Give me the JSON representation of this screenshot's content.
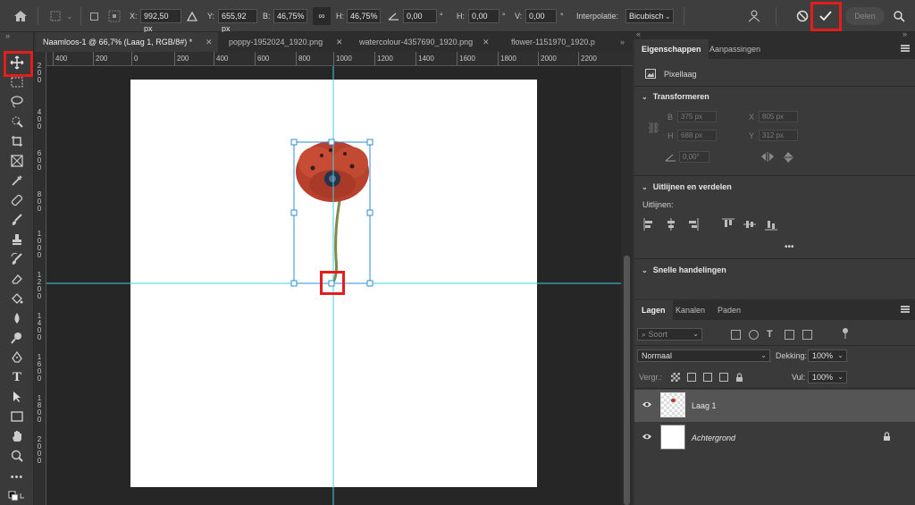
{
  "options_bar": {
    "x_label": "X:",
    "x_value": "992,50 px",
    "y_label": "Y:",
    "y_value": "655,92 px",
    "w_label": "B:",
    "w_value": "46,75%",
    "h_label": "H:",
    "h_value": "46,75%",
    "angle_value": "0,00",
    "degree": "°",
    "hskew_label": "H:",
    "hskew_value": "0,00",
    "vskew_label": "V:",
    "vskew_value": "0,00",
    "interp_label": "Interpolatie:",
    "interp_value": "Bicubisch",
    "share_label": "Delen"
  },
  "tabs": [
    {
      "label": "Naamloos-1 @ 66,7% (Laag 1, RGB/8#) *",
      "active": true
    },
    {
      "label": "poppy-1952024_1920.png",
      "active": false
    },
    {
      "label": "watercolour-4357690_1920.png",
      "active": false
    },
    {
      "label": "flower-1151970_1920.p",
      "active": false
    }
  ],
  "ruler_top": [
    "400",
    "200",
    "0",
    "200",
    "400",
    "600",
    "800",
    "1000",
    "1200",
    "1400",
    "1600",
    "1800",
    "2000",
    "2200"
  ],
  "ruler_left": [
    "2\n0\n0",
    "4\n0\n0",
    "6\n0\n0",
    "8\n0\n0",
    "1\n0\n0\n0",
    "1\n2\n0\n0",
    "1\n4\n0\n0",
    "1\n6\n0\n0",
    "1\n8\n0\n0",
    "2\n0\n0\n0"
  ],
  "properties": {
    "tab_properties": "Eigenschappen",
    "tab_adjustments": "Aanpassingen",
    "layer_type": "Pixellaag",
    "transform_title": "Transformeren",
    "w_label": "B",
    "w_value": "375 px",
    "x_label": "X",
    "x_value": "805 px",
    "h_label": "H",
    "h_value": "688 px",
    "y_label": "Y",
    "y_value": "312 px",
    "angle_value": "0,00°",
    "align_title": "Uitlijnen en verdelen",
    "align_label": "Uitlijnen:",
    "more": "•••",
    "quick_title": "Snelle handelingen"
  },
  "layers": {
    "tab_layers": "Lagen",
    "tab_channels": "Kanalen",
    "tab_paths": "Paden",
    "filter_label": "Soort",
    "blend_mode": "Normaal",
    "opacity_label": "Dekking:",
    "opacity_value": "100%",
    "lock_label": "Vergr.:",
    "fill_label": "Vul:",
    "fill_value": "100%",
    "items": [
      {
        "name": "Laag 1",
        "selected": true
      },
      {
        "name": "Achtergrond",
        "selected": false
      }
    ]
  },
  "colors": {
    "highlight": "#e31c1c",
    "guide": "#3fd2e6",
    "bounding_box": "#2f8cd8"
  }
}
